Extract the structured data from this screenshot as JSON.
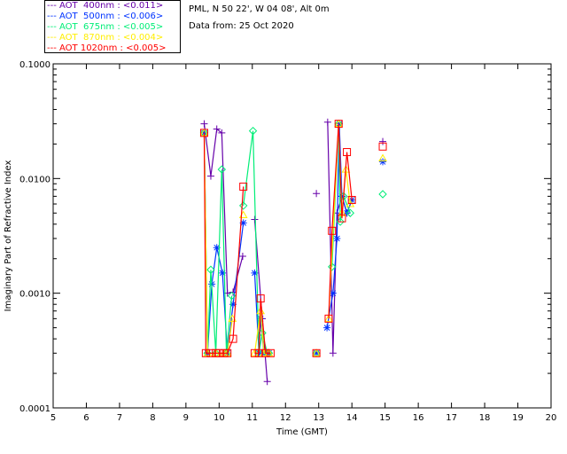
{
  "header": {
    "location": "PML, N 50 22', W 04 08', Alt 0m",
    "date": "Data from: 25 Oct 2020"
  },
  "chart_data": {
    "type": "line",
    "title": "",
    "xlabel": "Time (GMT)",
    "ylabel": "Imaginary Part of Refractive Index",
    "xlim": [
      5,
      20
    ],
    "ylim": [
      0.0001,
      0.1
    ],
    "yscale": "log",
    "xticks": [
      "5",
      "6",
      "7",
      "8",
      "9",
      "10",
      "11",
      "12",
      "13",
      "14",
      "15",
      "16",
      "17",
      "18",
      "19",
      "20"
    ],
    "yticks": [
      "0.0001",
      "0.0010",
      "0.0100",
      "0.1000"
    ],
    "grid": false,
    "legend_position": "top-left",
    "series": [
      {
        "name": "AOT  400nm : <0.011>",
        "color": "#6600aa",
        "marker": "plus",
        "points": [
          [
            9.55,
            0.03
          ],
          [
            9.75,
            0.0105
          ],
          [
            9.93,
            0.027
          ],
          [
            10.08,
            0.025
          ],
          [
            10.25,
            0.001
          ],
          [
            10.42,
            0.00102
          ],
          [
            10.71,
            0.0021
          ],
          [
            11.07,
            0.0044
          ],
          [
            11.3,
            0.0006
          ],
          [
            11.45,
            0.00017
          ],
          [
            12.93,
            0.0074
          ],
          [
            13.27,
            0.031
          ],
          [
            13.43,
            0.0003
          ],
          [
            13.55,
            0.005
          ],
          [
            13.7,
            0.007
          ],
          [
            13.85,
            0.005
          ],
          [
            14.0,
            0.0065
          ],
          [
            14.93,
            0.021
          ]
        ]
      },
      {
        "name": "AOT  500nm : <0.006>",
        "color": "#0033ff",
        "marker": "star",
        "points": [
          [
            9.55,
            0.025
          ],
          [
            9.65,
            0.0003
          ],
          [
            9.78,
            0.0012
          ],
          [
            9.93,
            0.0025
          ],
          [
            10.1,
            0.0015
          ],
          [
            10.25,
            0.0003
          ],
          [
            10.42,
            0.0008
          ],
          [
            10.73,
            0.0041
          ],
          [
            11.07,
            0.0015
          ],
          [
            11.2,
            0.0003
          ],
          [
            11.25,
            0.0006
          ],
          [
            11.35,
            0.0003
          ],
          [
            11.5,
            0.0003
          ],
          [
            12.93,
            0.0003
          ],
          [
            13.25,
            0.0005
          ],
          [
            13.43,
            0.001
          ],
          [
            13.55,
            0.003
          ],
          [
            13.62,
            0.03
          ],
          [
            13.7,
            0.007
          ],
          [
            13.85,
            0.005
          ],
          [
            14.0,
            0.0065
          ],
          [
            14.93,
            0.014
          ]
        ]
      },
      {
        "name": "AOT  675nm : <0.005>",
        "color": "#00ee77",
        "marker": "diamond",
        "points": [
          [
            9.55,
            0.025
          ],
          [
            9.65,
            0.0003
          ],
          [
            9.75,
            0.0016
          ],
          [
            9.9,
            0.0003
          ],
          [
            10.08,
            0.012
          ],
          [
            10.22,
            0.0003
          ],
          [
            10.38,
            0.00095
          ],
          [
            10.73,
            0.0058
          ],
          [
            11.02,
            0.026
          ],
          [
            11.2,
            0.0003
          ],
          [
            11.3,
            0.00045
          ],
          [
            11.45,
            0.0003
          ],
          [
            11.5,
            0.0003
          ],
          [
            12.93,
            0.0003
          ],
          [
            13.4,
            0.0017
          ],
          [
            13.6,
            0.03
          ],
          [
            13.65,
            0.0042
          ],
          [
            13.75,
            0.007
          ],
          [
            13.95,
            0.005
          ],
          [
            14.93,
            0.0073
          ]
        ]
      },
      {
        "name": "AOT  870nm : <0.004>",
        "color": "#ffee00",
        "marker": "triangle",
        "points": [
          [
            9.55,
            0.025
          ],
          [
            9.65,
            0.0003
          ],
          [
            9.9,
            0.0003
          ],
          [
            10.15,
            0.0003
          ],
          [
            10.25,
            0.0003
          ],
          [
            10.4,
            0.0006
          ],
          [
            10.73,
            0.0048
          ],
          [
            11.07,
            0.0003
          ],
          [
            11.25,
            0.0007
          ],
          [
            11.35,
            0.0003
          ],
          [
            11.5,
            0.0003
          ],
          [
            12.93,
            0.0003
          ],
          [
            13.3,
            0.0006
          ],
          [
            13.6,
            0.03
          ],
          [
            13.7,
            0.005
          ],
          [
            13.82,
            0.012
          ],
          [
            13.95,
            0.006
          ],
          [
            14.93,
            0.015
          ]
        ]
      },
      {
        "name": "AOT 1020nm : <0.005>",
        "color": "#ff0000",
        "marker": "square",
        "points": [
          [
            9.55,
            0.025
          ],
          [
            9.6,
            0.0003
          ],
          [
            9.75,
            0.0003
          ],
          [
            9.9,
            0.0003
          ],
          [
            10.0,
            0.0003
          ],
          [
            10.15,
            0.0003
          ],
          [
            10.25,
            0.0003
          ],
          [
            10.42,
            0.0004
          ],
          [
            10.73,
            0.0085
          ],
          [
            11.07,
            0.0003
          ],
          [
            11.2,
            0.0003
          ],
          [
            11.25,
            0.0009
          ],
          [
            11.4,
            0.0003
          ],
          [
            11.55,
            0.0003
          ],
          [
            12.93,
            0.0003
          ],
          [
            13.3,
            0.0006
          ],
          [
            13.4,
            0.0035
          ],
          [
            13.6,
            0.03
          ],
          [
            13.7,
            0.0045
          ],
          [
            13.85,
            0.017
          ],
          [
            14.0,
            0.0065
          ],
          [
            14.93,
            0.019
          ]
        ]
      }
    ]
  }
}
